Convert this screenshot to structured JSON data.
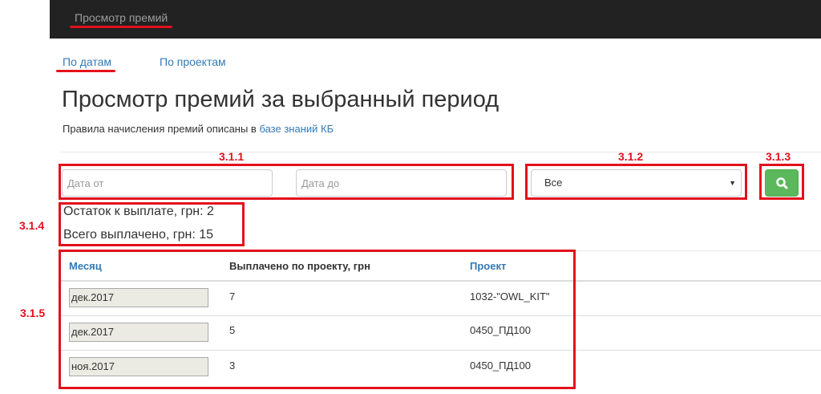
{
  "topbar": {
    "brand": "Просмотр премий"
  },
  "nav": {
    "by_dates": "По датам",
    "by_projects": "По проектам"
  },
  "page": {
    "title": "Просмотр премий за выбранный период",
    "subtitle_prefix": "Правила начисления премий описаны в ",
    "subtitle_link": "базе знаний КБ"
  },
  "filters": {
    "date_from_placeholder": "Дата от",
    "date_to_placeholder": "Дата до",
    "project_selected": "Все"
  },
  "stats": {
    "remaining": "Остаток к выплате, грн: 2",
    "paid_total": "Всего выплачено, грн: 15"
  },
  "table": {
    "headers": [
      "Месяц",
      "Выплачено по проекту, грн",
      "Проект"
    ],
    "rows": [
      {
        "month": "дек.2017",
        "paid": "7",
        "project": "1032-\"OWL_KIT\""
      },
      {
        "month": "дек.2017",
        "paid": "5",
        "project": "0450_ПД100"
      },
      {
        "month": "ноя.2017",
        "paid": "3",
        "project": "0450_ПД100"
      }
    ]
  },
  "annotations": {
    "filters_dates": "3.1.1",
    "filters_project": "3.1.2",
    "search": "3.1.3",
    "stats": "3.1.4",
    "table": "3.1.5"
  },
  "colors": {
    "annotation": "#e3101c",
    "link": "#337ab7",
    "success": "#5cb85c",
    "navbar": "#222222"
  },
  "icons": {
    "search": "search-icon",
    "caret": "caret-down-icon"
  }
}
